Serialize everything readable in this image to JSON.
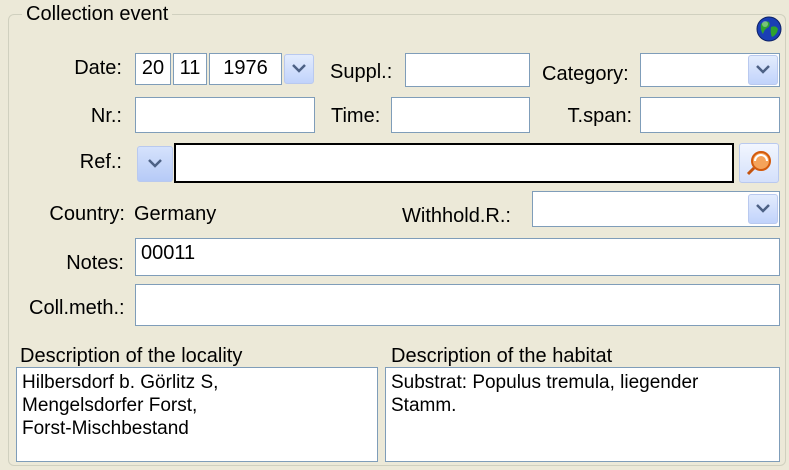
{
  "group": {
    "title": "Collection event",
    "globe_icon": "globe-icon"
  },
  "date": {
    "label": "Date:",
    "day": "20",
    "month": "11",
    "year": "1976"
  },
  "suppl": {
    "label": "Suppl.:",
    "value": ""
  },
  "category": {
    "label": "Category:",
    "value": ""
  },
  "nr": {
    "label": "Nr.:",
    "value": ""
  },
  "time": {
    "label": "Time:",
    "value": ""
  },
  "tspan": {
    "label": "T.span:",
    "value": ""
  },
  "ref": {
    "label": "Ref.:",
    "value": ""
  },
  "country": {
    "label": "Country:",
    "value": "Germany"
  },
  "withhold": {
    "label": "Withhold.R.:",
    "value": ""
  },
  "notes": {
    "label": "Notes:",
    "value": "00011"
  },
  "collmeth": {
    "label": "Coll.meth.:",
    "value": ""
  },
  "locality": {
    "label": "Description of the locality",
    "lines": [
      "Hilbersdorf b. Görlitz S,",
      "Mengelsdorfer Forst,",
      "Forst-Mischbestand"
    ]
  },
  "habitat": {
    "label": "Description of the habitat",
    "lines": [
      "Substrat: Populus tremula, liegender",
      "Stamm."
    ]
  },
  "colors": {
    "field_border": "#7f9db9",
    "background": "#ece9d8",
    "combo_arrow": "#4d6185"
  }
}
